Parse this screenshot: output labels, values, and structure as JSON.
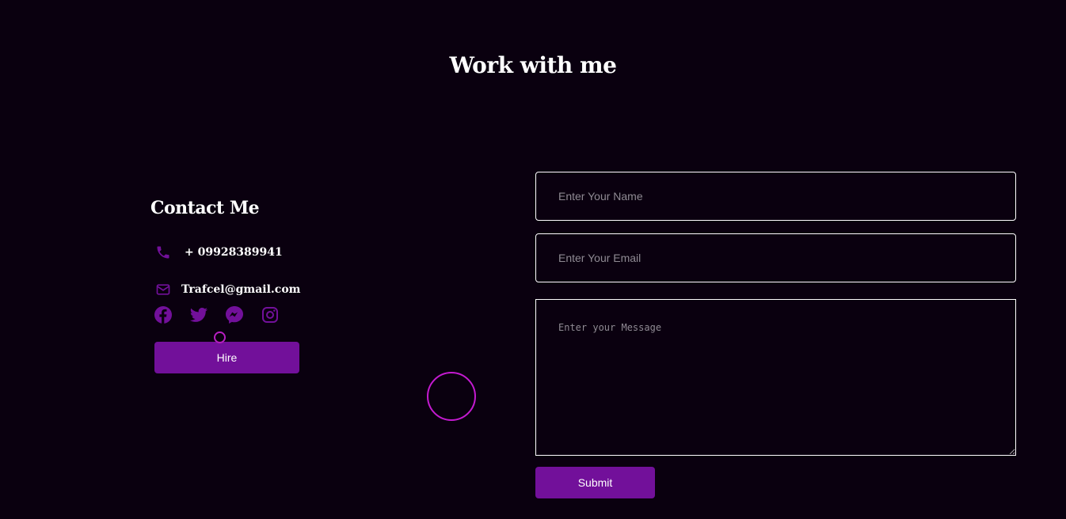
{
  "section": {
    "title": "Work with me"
  },
  "contact": {
    "heading": "Contact Me",
    "phone": {
      "icon": "phone-icon",
      "text": "+ 09928389941"
    },
    "email": {
      "icon": "envelope-icon",
      "text": "Trafcel@gmail.com"
    },
    "socials": [
      "facebook-icon",
      "twitter-icon",
      "messenger-icon",
      "instagram-icon"
    ],
    "hire_label": "Hire"
  },
  "form": {
    "name_placeholder": "Enter Your Name",
    "email_placeholder": "Enter Your Email",
    "message_placeholder": "Enter your Message",
    "submit_label": "Submit"
  },
  "colors": {
    "background": "#0a000f",
    "accent": "#72109a",
    "cursor": "#c41ad0",
    "text": "#ffffff"
  }
}
